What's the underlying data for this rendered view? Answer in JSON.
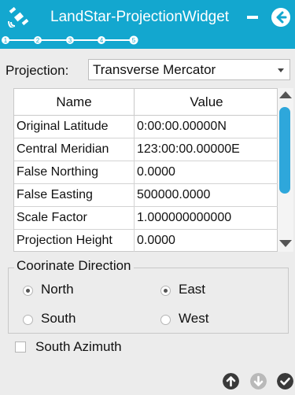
{
  "titlebar": {
    "title": "LandStar-ProjectionWidget",
    "icons": {
      "app": "satellite-icon",
      "minimize": "minimize-icon",
      "back": "back-arrow-icon"
    },
    "color": "#13a7cf"
  },
  "steps": {
    "labels": [
      "1",
      "2",
      "3",
      "4",
      "5"
    ],
    "current": 5
  },
  "projection": {
    "label": "Projection:",
    "value": "Transverse Mercator"
  },
  "table": {
    "columns": [
      "Name",
      "Value"
    ],
    "rows": [
      {
        "name": "Original Latitude",
        "value": "0:00:00.00000N"
      },
      {
        "name": "Central Meridian",
        "value": "123:00:00.00000E"
      },
      {
        "name": "False Northing",
        "value": "0.0000"
      },
      {
        "name": "False Easting",
        "value": "500000.0000"
      },
      {
        "name": "Scale Factor",
        "value": "1.000000000000"
      },
      {
        "name": "Projection Height",
        "value": "0.0000"
      }
    ]
  },
  "direction": {
    "legend": "Coorinate Direction",
    "options": [
      {
        "label": "North",
        "selected": true
      },
      {
        "label": "East",
        "selected": true
      },
      {
        "label": "South",
        "selected": false
      },
      {
        "label": "West",
        "selected": false
      }
    ]
  },
  "south_azimuth": {
    "label": "South Azimuth",
    "checked": false
  },
  "bottom_actions": [
    {
      "icon": "arrow-up-circle-icon",
      "enabled": true
    },
    {
      "icon": "arrow-down-circle-icon",
      "enabled": false
    },
    {
      "icon": "check-circle-icon",
      "enabled": true
    }
  ]
}
